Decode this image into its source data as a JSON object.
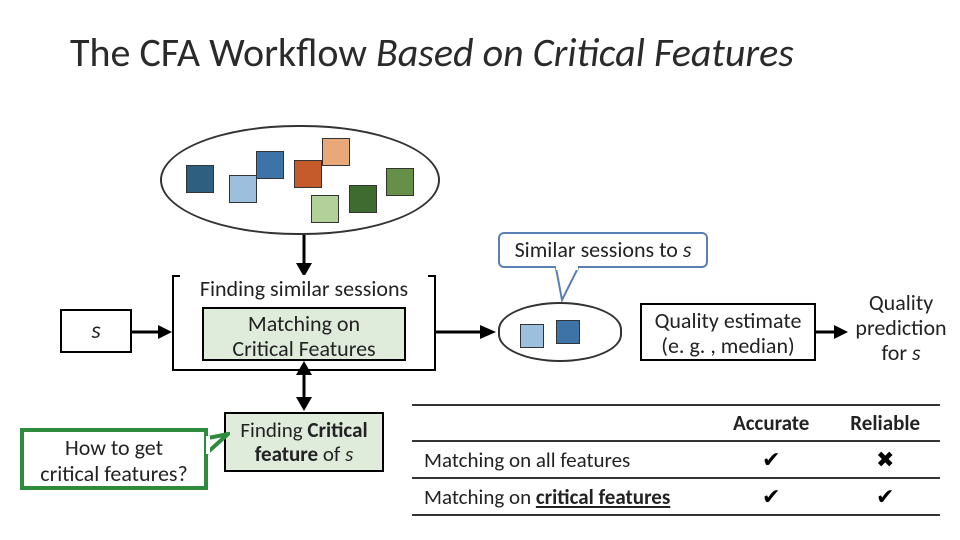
{
  "title_plain": "The CFA Workflow ",
  "title_em": "Based on Critical Features",
  "s_label": "s",
  "finding_similar": "Finding similar sessions",
  "matching_critical_line1": "Matching on",
  "matching_critical_line2": "Critical Features",
  "similar_callout_prefix": "Similar sessions to ",
  "similar_callout_em": "s",
  "quality_estimate_line1": "Quality estimate",
  "quality_estimate_line2": "(e. g. , median)",
  "quality_pred_line1": "Quality",
  "quality_pred_line2": "prediction",
  "quality_pred_line3_prefix": "for ",
  "quality_pred_line3_em": "s",
  "fcf_prefix": "Finding ",
  "fcf_bold": "Critical feature",
  "fcf_suffix_prefix": " of ",
  "fcf_suffix_em": "s",
  "how_line1": "How to get",
  "how_line2": "critical features?",
  "table": {
    "col_accurate": "Accurate",
    "col_reliable": "Reliable",
    "row1_label": "Matching on all features",
    "row1_acc": "✔",
    "row1_rel": "✖",
    "row2_prefix": "Matching on ",
    "row2_bold": "critical features",
    "row2_acc": "✔",
    "row2_rel": "✔"
  },
  "colors": {
    "sq1": "#2f5f80",
    "sq2": "#9dbfde",
    "sq3": "#3d74a8",
    "sq4": "#c55a2a",
    "sq5": "#e8a879",
    "sq6": "#b1d09a",
    "sq7": "#3e6b30",
    "sq8": "#668f48",
    "sm1": "#9dbfde",
    "sm2": "#3d74a8"
  }
}
